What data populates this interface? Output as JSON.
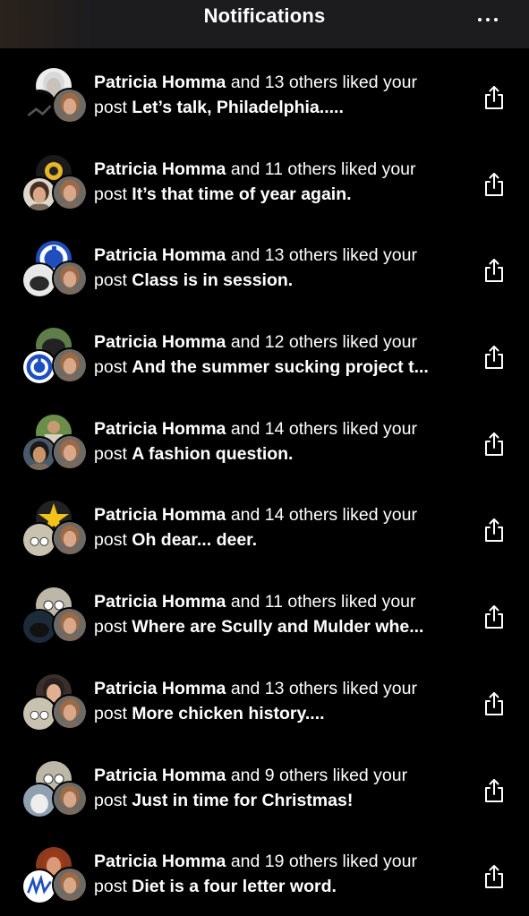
{
  "header": {
    "title": "Notifications",
    "more_icon": "ellipsis-icon"
  },
  "notifications": [
    {
      "name": "Patricia Homma",
      "action": " and 13 others liked your",
      "prefix": "post ",
      "post_title": "Let’s talk, Philadelphia.....",
      "share_icon": "share-icon"
    },
    {
      "name": "Patricia Homma",
      "action": " and 11 others liked your",
      "prefix": "post ",
      "post_title": "It’s that time of year again.",
      "share_icon": "share-icon"
    },
    {
      "name": "Patricia Homma",
      "action": " and 13 others liked your",
      "prefix": "post ",
      "post_title": "Class is in session.",
      "share_icon": "share-icon"
    },
    {
      "name": "Patricia Homma",
      "action": " and 12 others liked your",
      "prefix": "post ",
      "post_title": "And the summer sucking project t...",
      "share_icon": "share-icon"
    },
    {
      "name": "Patricia Homma",
      "action": " and 14 others liked your",
      "prefix": "post ",
      "post_title": "A fashion question.",
      "share_icon": "share-icon"
    },
    {
      "name": "Patricia Homma",
      "action": " and 14 others liked your",
      "prefix": "post ",
      "post_title": "Oh dear... deer.",
      "share_icon": "share-icon"
    },
    {
      "name": "Patricia Homma",
      "action": " and 11 others liked your",
      "prefix": "post ",
      "post_title": "Where are Scully and Mulder whe...",
      "share_icon": "share-icon"
    },
    {
      "name": "Patricia Homma",
      "action": " and 13 others liked your",
      "prefix": "post ",
      "post_title": "More chicken history....",
      "share_icon": "share-icon"
    },
    {
      "name": "Patricia Homma",
      "action": " and 9 others liked your",
      "prefix": "post ",
      "post_title": "Just in time for Christmas!",
      "share_icon": "share-icon"
    },
    {
      "name": "Patricia Homma",
      "action": " and 19 others liked your",
      "prefix": "post ",
      "post_title": "Diet is a four letter word.",
      "share_icon": "share-icon"
    }
  ]
}
